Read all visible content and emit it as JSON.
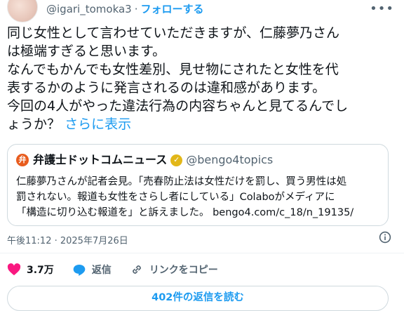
{
  "author": {
    "handle": "@igari_tomoka3",
    "separator": "·",
    "follow_label": "フォローする"
  },
  "tweet": {
    "lines": [
      "同じ女性として言わせていただきますが、仁藤夢乃さん",
      "は極端すぎると思います。",
      "なんでもかんでも女性差別、見せ物にされたと女性を代",
      "表するかのように発言されるのは違和感があります。",
      "今回の4人がやった違法行為の内容ちゃんと見てるんでし",
      "ょうか？"
    ],
    "show_more": "さらに表示"
  },
  "quote": {
    "logo_text": "弁",
    "name": "弁護士ドットコムニュース",
    "verified_mark": "✓",
    "handle": "@bengo4topics",
    "lines": [
      "仁藤夢乃さんが記者会見。「売春防止法は女性だけを罰し、買う男性は処",
      "罰されない。報道も女性をさらし者にしている」Colaboがメディアに",
      "「構造に切り込む報道を」と訴えました。 bengo4.com/c_18/n_19135/"
    ]
  },
  "meta": {
    "timestamp": "午後11:12 · 2025年7月26日"
  },
  "actions": {
    "like_count": "3.7万",
    "reply_label": "返信",
    "copy_link_label": "リンクをコピー"
  },
  "replies_button": "402件の返信を読む",
  "colors": {
    "accent": "#1d9bf0",
    "like": "#f91880",
    "text": "#0f1419",
    "secondary": "#536471",
    "border": "#cfd9de",
    "verified": "#e2b719"
  },
  "icons": [
    "more-horizontal-icon",
    "verified-badge-icon",
    "info-icon",
    "heart-icon",
    "reply-bubble-icon",
    "link-icon"
  ]
}
